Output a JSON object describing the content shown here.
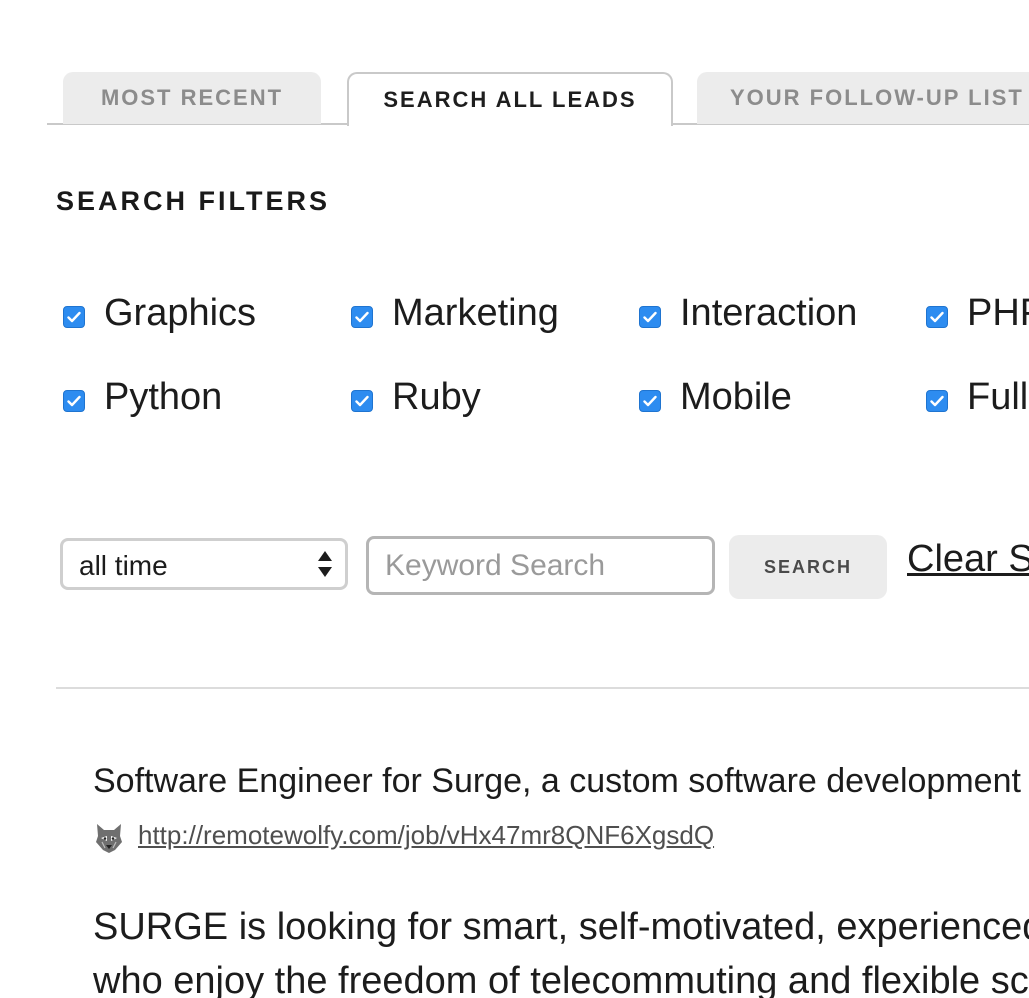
{
  "tabs": [
    {
      "label": "MOST RECENT",
      "active": false
    },
    {
      "label": "SEARCH ALL LEADS",
      "active": true
    },
    {
      "label": "YOUR FOLLOW-UP LIST",
      "active": false
    }
  ],
  "filters": {
    "heading": "SEARCH FILTERS",
    "items": [
      {
        "label": "Graphics",
        "checked": true
      },
      {
        "label": "Marketing",
        "checked": true
      },
      {
        "label": "Interaction",
        "checked": true
      },
      {
        "label": "PHP",
        "checked": true
      },
      {
        "label": "Python",
        "checked": true
      },
      {
        "label": "Ruby",
        "checked": true
      },
      {
        "label": "Mobile",
        "checked": true
      },
      {
        "label": "Full",
        "checked": true
      }
    ]
  },
  "search": {
    "time_range": "all time",
    "keyword_placeholder": "Keyword Search",
    "keyword_value": "",
    "button_label": "SEARCH",
    "clear_label": "Clear Search"
  },
  "result": {
    "title": "Software Engineer for Surge, a custom software development",
    "source_icon": "wolf-icon",
    "link": "http://remotewolfy.com/job/vHx47mr8QNF6XgsdQ",
    "description_lines": [
      "SURGE is looking for smart, self-motivated, experienced,",
      "who enjoy the freedom of telecommuting and flexible sche"
    ]
  },
  "colors": {
    "checkbox": "#2d8cf0",
    "tab_inactive_bg": "#ececec",
    "tab_inactive_text": "#8c8c8c",
    "button_bg": "#ececec"
  }
}
